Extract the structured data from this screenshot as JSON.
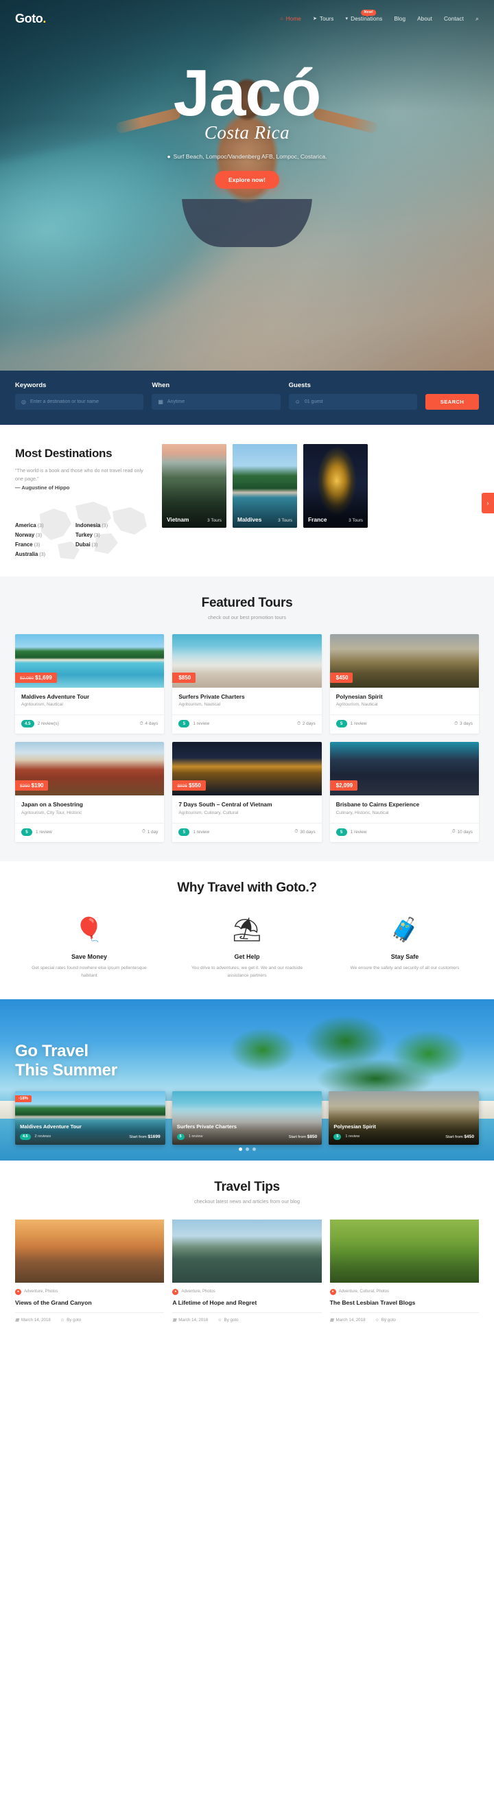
{
  "brand": {
    "name": "Goto",
    "dot": "."
  },
  "nav": {
    "items": [
      {
        "label": "Home",
        "icon": "home-icon",
        "glyph": "⌂",
        "active": true,
        "badge": null
      },
      {
        "label": "Tours",
        "icon": "paper-plane-icon",
        "glyph": "➤",
        "active": false,
        "badge": null
      },
      {
        "label": "Destinations",
        "icon": "map-pin-icon",
        "glyph": "▾",
        "active": false,
        "badge": "New!"
      },
      {
        "label": "Blog",
        "icon": null,
        "glyph": "",
        "active": false,
        "badge": null
      },
      {
        "label": "About",
        "icon": null,
        "glyph": "",
        "active": false,
        "badge": null
      },
      {
        "label": "Contact",
        "icon": null,
        "glyph": "",
        "active": false,
        "badge": null
      }
    ],
    "search_icon": "search-icon",
    "search_glyph": "⌕"
  },
  "hero": {
    "title": "Jacó",
    "subtitle": "Costa Rica",
    "location": "Surf Beach, Lompoc/Vandenberg AFB, Lompoc, Costarica.",
    "location_icon": "map-pin-icon",
    "cta": "Explore now!"
  },
  "searchbar": {
    "keywords_label": "Keywords",
    "keywords_placeholder": "Enter a destination or tour name",
    "keywords_value": "",
    "keywords_icon": "map-pin-icon",
    "when_label": "When",
    "when_placeholder": "Anytime",
    "when_value": "",
    "when_icon": "calendar-icon",
    "guests_label": "Guests",
    "guests_placeholder": "01 guest",
    "guests_value": "",
    "guests_icon": "user-icon",
    "search_button": "SEARCH"
  },
  "destinations": {
    "heading": "Most Destinations",
    "quote": "\"The world is a book and those who do not travel read only one page.\"",
    "author": "— Augustine of Hippo",
    "countries": [
      {
        "name": "America",
        "count": "(3)"
      },
      {
        "name": "Indonesia",
        "count": "(3)"
      },
      {
        "name": "Norway",
        "count": "(3)"
      },
      {
        "name": "Turkey",
        "count": "(3)"
      },
      {
        "name": "France",
        "count": "(3)"
      },
      {
        "name": "Dubai",
        "count": "(3)"
      },
      {
        "name": "Australia",
        "count": "(3)"
      }
    ],
    "cards": [
      {
        "name": "Vietnam",
        "tours": "3 Tours",
        "img": "img-vietnam"
      },
      {
        "name": "Maldives",
        "tours": "3 Tours",
        "img": "img-maldives"
      },
      {
        "name": "France",
        "tours": "3 Tours",
        "img": "img-france"
      }
    ],
    "next_arrow": "›"
  },
  "featured": {
    "title": "Featured Tours",
    "subtitle": "check out our best promotion tours",
    "tours": [
      {
        "name": "Maldives Adventure Tour",
        "cats": "Agritourism, Nautical",
        "old_price": "$2,060",
        "price": "$1,699",
        "rating": "4.5",
        "reviews": "2 review(s)",
        "duration": "4 days",
        "img": "bg-maldives"
      },
      {
        "name": "Surfers Private Charters",
        "cats": "Agritourism, Nautical",
        "old_price": "",
        "price": "$850",
        "rating": "5",
        "reviews": "1 review",
        "duration": "2 days",
        "img": "bg-surf"
      },
      {
        "name": "Polynesian Spirit",
        "cats": "Agritourism, Nautical",
        "old_price": "",
        "price": "$450",
        "rating": "5",
        "reviews": "1 review",
        "duration": "3 days",
        "img": "bg-poly"
      },
      {
        "name": "Japan on a Shoestring",
        "cats": "Agritourism, City Tour, Historic",
        "old_price": "$250",
        "price": "$190",
        "rating": "5",
        "reviews": "1 review",
        "duration": "1 day",
        "img": "bg-japan"
      },
      {
        "name": "7 Days South – Central of Vietnam",
        "cats": "Agritourism, Culinary, Cultural",
        "old_price": "$925",
        "price": "$550",
        "rating": "5",
        "reviews": "1 review",
        "duration": "30 days",
        "img": "bg-vietnam2"
      },
      {
        "name": "Brisbane to Cairns Experience",
        "cats": "Culinary, Historic, Nautical",
        "old_price": "",
        "price": "$2,099",
        "rating": "5",
        "reviews": "1 review",
        "duration": "10 days",
        "img": "bg-brisbane"
      }
    ]
  },
  "why": {
    "title": "Why Travel with Goto.?",
    "items": [
      {
        "icon": "hot-air-balloon-icon",
        "glyph": "🎈",
        "title": "Save Money",
        "desc": "Get special rates found nowhere else ipsum pellentesque habitant"
      },
      {
        "icon": "beach-umbrella-icon",
        "glyph": "⛱",
        "title": "Get Help",
        "desc": "You drive to adventures, we get it. We and our roadside assistance partners"
      },
      {
        "icon": "luggage-icon",
        "glyph": "🧳",
        "title": "Stay Safe",
        "desc": "We ensure the safety and security of all our customers"
      }
    ]
  },
  "summer": {
    "line1": "Go Travel",
    "line2": "This Summer",
    "cards": [
      {
        "name": "Maldives Adventure Tour",
        "discount": "-18%",
        "rating": "4.5",
        "reviews": "2 reviews",
        "from_label": "Start from",
        "price": "$1699",
        "img": "bg-maldives"
      },
      {
        "name": "Surfers Private Charters",
        "discount": "",
        "rating": "5",
        "reviews": "1 review",
        "from_label": "Start from",
        "price": "$850",
        "img": "bg-surf"
      },
      {
        "name": "Polynesian Spirit",
        "discount": "",
        "rating": "5",
        "reviews": "1 review",
        "from_label": "Start from",
        "price": "$450",
        "img": "bg-poly"
      }
    ],
    "dots": [
      true,
      false,
      false
    ]
  },
  "tips": {
    "title": "Travel Tips",
    "subtitle": "checkout latest news and articles from our blog",
    "posts": [
      {
        "cats": "Adventure, Photos",
        "title": "Views of the Grand Canyon",
        "date": "March 14, 2018",
        "author": "By goto",
        "img": "bg-canyon"
      },
      {
        "cats": "Adventure, Photos",
        "title": "A Lifetime of Hope and Regret",
        "date": "March 14, 2018",
        "author": "By goto",
        "img": "bg-thai"
      },
      {
        "cats": "Adventure, Cultural, Photos",
        "title": "The Best Lesbian Travel Blogs",
        "date": "March 14, 2018",
        "author": "By goto",
        "img": "bg-rice"
      }
    ],
    "date_icon": "calendar-icon",
    "author_icon": "user-icon"
  }
}
